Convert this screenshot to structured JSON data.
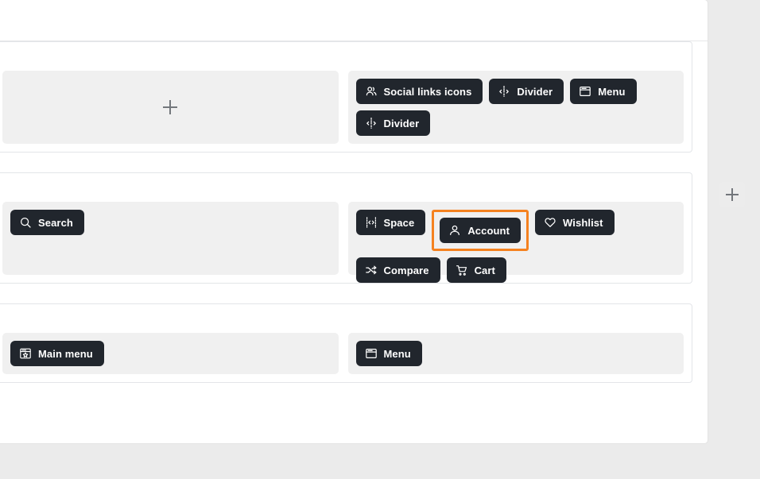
{
  "theme": {
    "chip_bg": "#21262d",
    "chip_text": "#ffffff",
    "dropzone_bg": "#f0f0f0",
    "surface_bg": "#ffffff",
    "page_bg": "#ebebeb",
    "selection_outline": "#f58220"
  },
  "sections": [
    {
      "name": "top-bar-section",
      "left_zone": {
        "empty": true,
        "add_icon": "plus-icon",
        "items": []
      },
      "right_zone": {
        "empty": false,
        "items": [
          {
            "label": "Social links icons",
            "icon": "social-links-icon"
          },
          {
            "label": "Divider",
            "icon": "divider-icon"
          },
          {
            "label": "Menu",
            "icon": "menu-window-icon"
          },
          {
            "label": "Divider",
            "icon": "divider-icon"
          }
        ]
      }
    },
    {
      "name": "middle-bar-section",
      "left_zone": {
        "empty": false,
        "items": [
          {
            "label": "Search",
            "icon": "search-icon"
          }
        ]
      },
      "right_zone": {
        "empty": false,
        "items": [
          {
            "label": "Space",
            "icon": "space-icon",
            "selected": false
          },
          {
            "label": "Account",
            "icon": "account-icon",
            "selected": true
          },
          {
            "label": "Wishlist",
            "icon": "heart-icon",
            "selected": false
          },
          {
            "label": "Compare",
            "icon": "compare-icon",
            "selected": false
          },
          {
            "label": "Cart",
            "icon": "cart-icon",
            "selected": false
          }
        ]
      },
      "add_button": {
        "icon": "plus-icon",
        "label": ""
      }
    },
    {
      "name": "bottom-bar-section",
      "left_zone": {
        "empty": false,
        "items": [
          {
            "label": "Main menu",
            "icon": "main-menu-icon"
          }
        ]
      },
      "right_zone": {
        "empty": false,
        "items": [
          {
            "label": "Menu",
            "icon": "menu-window-icon"
          }
        ]
      }
    }
  ]
}
